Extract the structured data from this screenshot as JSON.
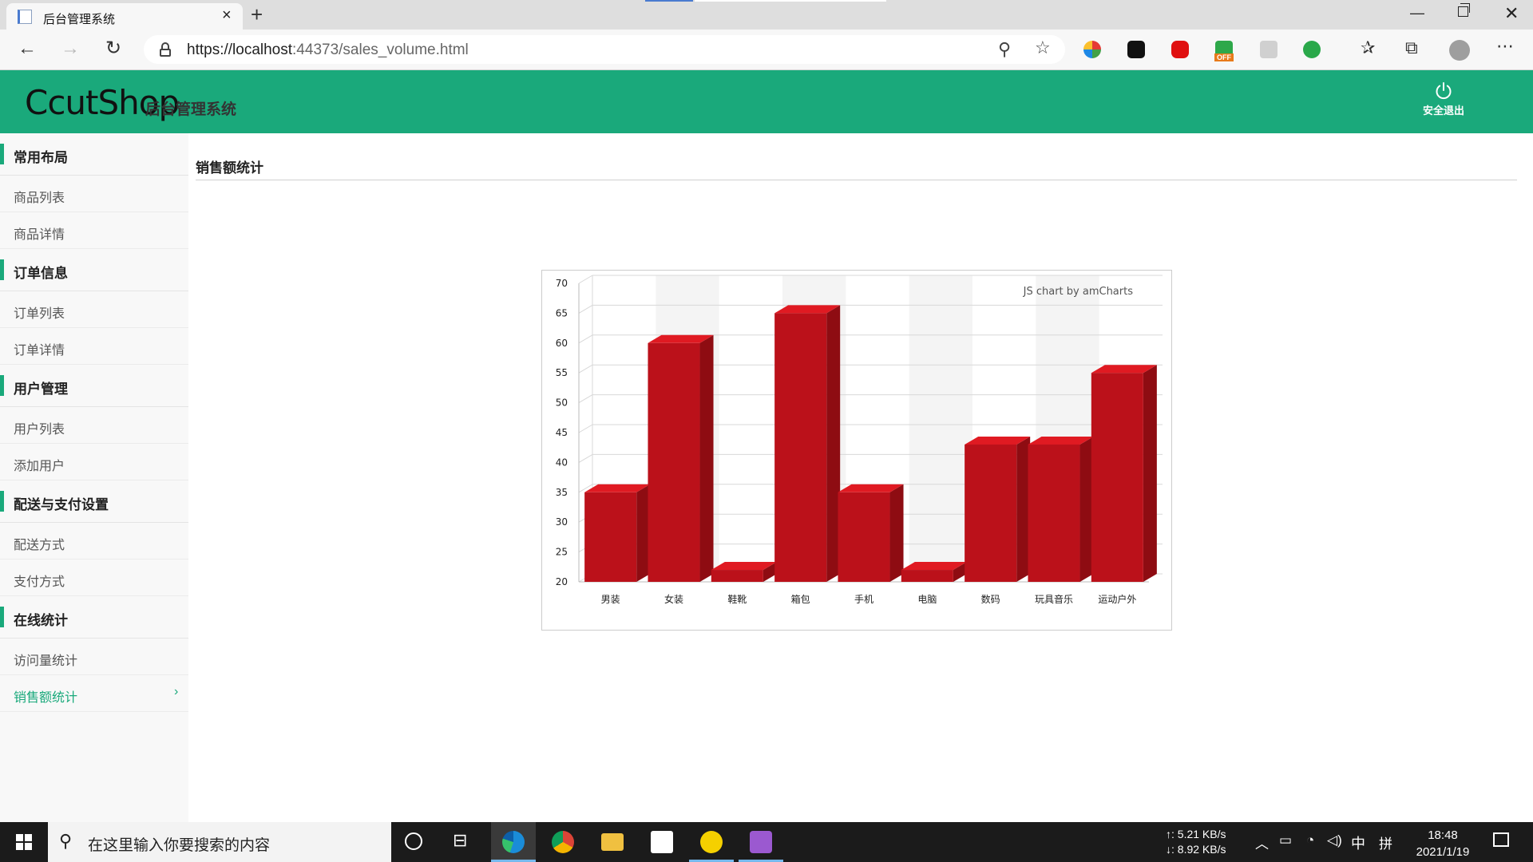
{
  "browser": {
    "tab_title": "后台管理系统",
    "url_host": "https://localhost",
    "url_rest": ":44373/sales_volume.html",
    "window_controls": {
      "minimize": "—",
      "close": "✕"
    }
  },
  "header": {
    "logo": "CcutShop",
    "subtitle": "后台管理系统",
    "logout_label": "安全退出",
    "accent_color": "#1aa97b"
  },
  "sidebar": {
    "groups": [
      {
        "title": "常用布局",
        "items": [
          "商品列表",
          "商品详情"
        ]
      },
      {
        "title": "订单信息",
        "items": [
          "订单列表",
          "订单详情"
        ]
      },
      {
        "title": "用户管理",
        "items": [
          "用户列表",
          "添加用户"
        ]
      },
      {
        "title": "配送与支付设置",
        "items": [
          "配送方式",
          "支付方式"
        ]
      },
      {
        "title": "在线统计",
        "items": [
          "访问量统计",
          "销售额统计"
        ]
      }
    ],
    "active_item": "销售额统计"
  },
  "main": {
    "page_title": "销售额统计"
  },
  "chart_data": {
    "type": "bar",
    "style": "3d-column",
    "categories": [
      "男装",
      "女装",
      "鞋靴",
      "箱包",
      "手机",
      "电脑",
      "数码",
      "玩具音乐",
      "运动户外"
    ],
    "values": [
      35,
      60,
      22,
      65,
      35,
      22,
      43,
      43,
      55
    ],
    "ylim": [
      20,
      70
    ],
    "yticks": [
      20,
      25,
      30,
      35,
      40,
      45,
      50,
      55,
      60,
      65,
      70
    ],
    "bar_color": "#bb111a",
    "credit": "JS chart by amCharts",
    "grid": true,
    "alternating_column_bands": true
  },
  "taskbar": {
    "search_placeholder": "在这里输入你要搜索的内容",
    "net_up": "↑: 5.21 KB/s",
    "net_down": "↓: 8.92 KB/s",
    "ime": "中",
    "ime2": "拼",
    "time": "18:48",
    "date": "2021/1/19"
  }
}
